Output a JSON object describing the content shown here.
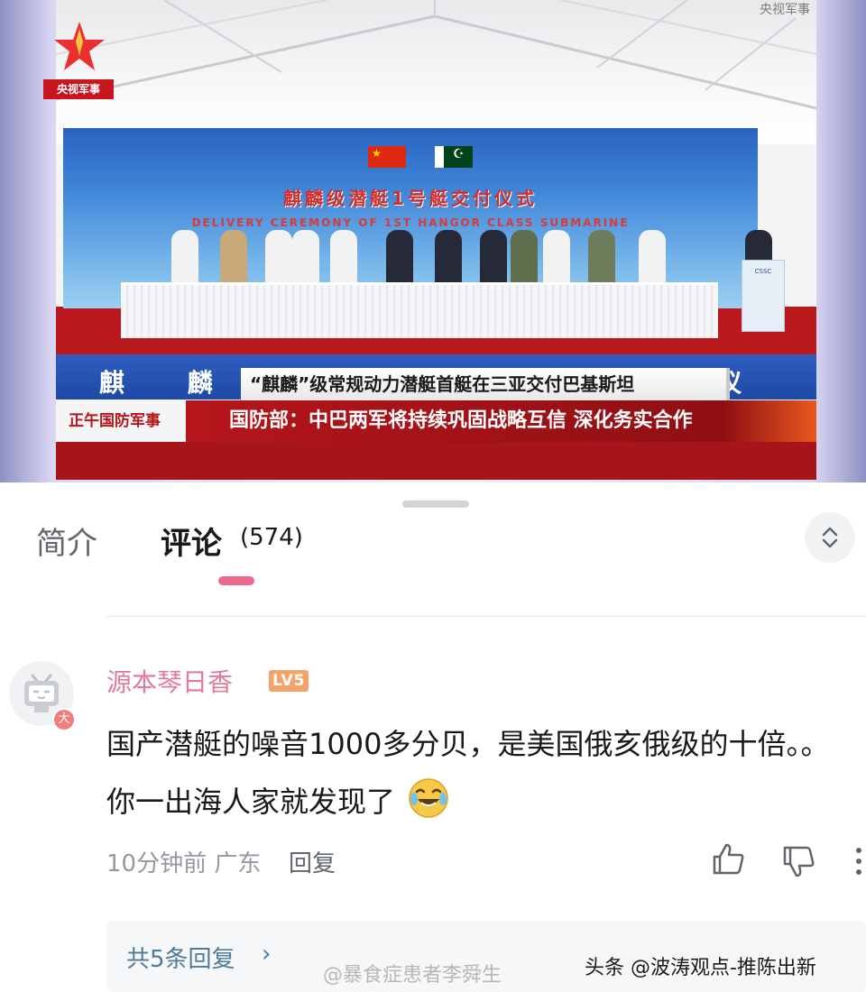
{
  "video": {
    "channel_logo_text": "央视军事",
    "watermark": "央视军事",
    "backdrop_title": "麒麟级潜艇1号艇交付仪式",
    "backdrop_subtitle": "DELIVERY CEREMONY OF 1ST HANGOR CLASS SUBMARINE",
    "lower_banner_text": "麒 麟 级 潜 艇 交 付 仪 式",
    "caption_headline": "“麒麟”级常规动力潜艇首艇在三亚交付巴基斯坦",
    "program_name": "正午国防军事",
    "caption_news": "国防部：中巴两军将持续巩固战略互信 深化务实合作",
    "podium_text": "CSSC"
  },
  "tabs": {
    "intro_label": "简介",
    "comments_label": "评论",
    "comments_count": "(574)"
  },
  "comment": {
    "username": "源本琴日香",
    "level": "LV5",
    "badge": "大",
    "text": "国产潜艇的噪音1000多分贝，是美国俄亥俄级的十倍。。你一出海人家就发现了",
    "time": "10分钟前",
    "location": "广东",
    "reply_label": "回复",
    "emoji": "crying-laughing-emoji"
  },
  "replies": {
    "label": "共5条回复",
    "chevron": "›"
  },
  "watermarks": {
    "weibo": "@暴食症患者李舜生",
    "toutiao": "头条 @波涛观点-推陈出新"
  },
  "colors": {
    "accent_pink": "#ea6b8f",
    "username_pink": "#e27b97",
    "level_orange": "#f6a36a",
    "reply_blue": "#4f7b9a",
    "cctv_red": "#c8161e"
  }
}
